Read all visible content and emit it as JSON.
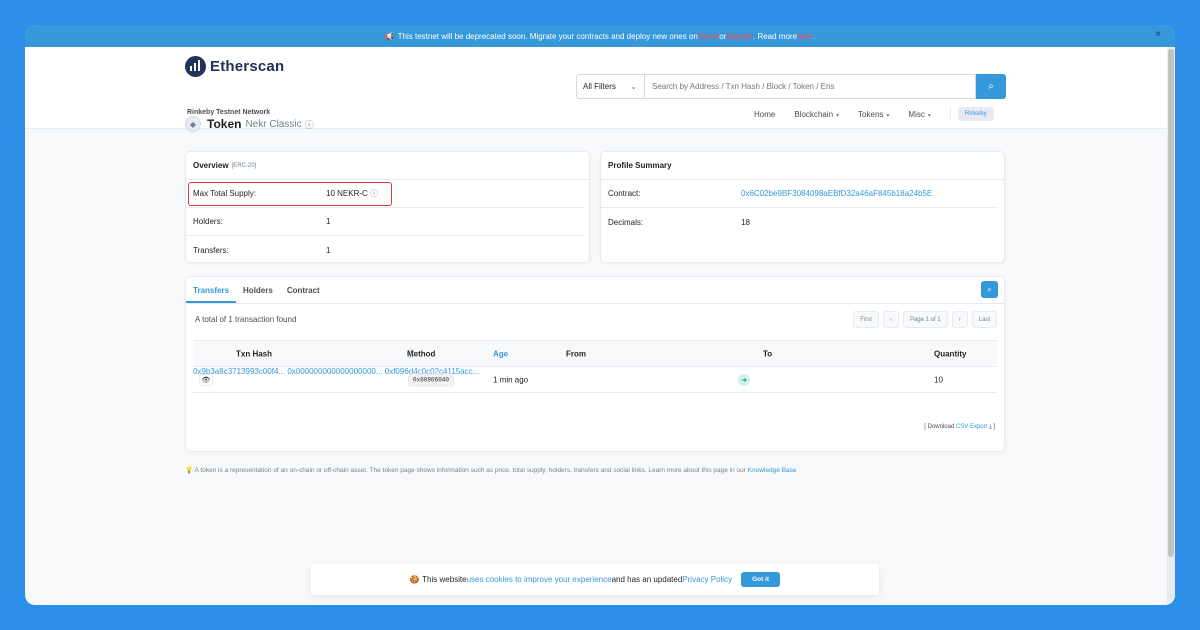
{
  "banner": {
    "text_before": "This testnet will be deprecated soon. Migrate your contracts and deploy new ones on ",
    "link1": "Goerli",
    "text_mid": " or ",
    "link2": "Sepolia",
    "text_after": ". Read more ",
    "link3": "here",
    "text_end": "."
  },
  "header": {
    "logo_text": "Etherscan",
    "network_label": "Rinkeby Testnet Network",
    "search": {
      "filter": "All Filters",
      "placeholder": "Search by Address / Txn Hash / Block / Token / Ens"
    },
    "nav": [
      {
        "label": "Home",
        "dropdown": false
      },
      {
        "label": "Blockchain",
        "dropdown": true
      },
      {
        "label": "Tokens",
        "dropdown": true
      },
      {
        "label": "Misc",
        "dropdown": true
      }
    ],
    "network_badge": "Rinkeby"
  },
  "token": {
    "title": "Token",
    "name": "Nekr Classic"
  },
  "overview": {
    "title": "Overview",
    "subtitle": "[ERC-20]",
    "rows": [
      {
        "label": "Max Total Supply:",
        "value": "10 NEKR-C"
      },
      {
        "label": "Holders:",
        "value": "1"
      },
      {
        "label": "Transfers:",
        "value": "1"
      }
    ]
  },
  "profile": {
    "title": "Profile Summary",
    "rows": [
      {
        "label": "Contract:",
        "value": "0x6C02be9BF3084098aEBfD32a46aF845b18a24b5E"
      },
      {
        "label": "Decimals:",
        "value": "18"
      }
    ]
  },
  "transfers": {
    "tabs": [
      "Transfers",
      "Holders",
      "Contract"
    ],
    "found_text": "A total of 1 transaction found",
    "pager": {
      "first": "First",
      "prev": "‹",
      "page": "Page 1 of 1",
      "next": "›",
      "last": "Last"
    },
    "columns": {
      "hash": "Txn Hash",
      "method": "Method",
      "age": "Age",
      "from": "From",
      "to": "To",
      "quantity": "Quantity"
    },
    "rows": [
      {
        "hash": "0x9b3a8c3713993c00f4...",
        "method": "0x60806040",
        "age": "1 min ago",
        "from": "0x000000000000000000...",
        "to": "0xf096d4c0c02c4115acc...",
        "quantity": "10"
      }
    ],
    "csv": {
      "prefix": "[ Download ",
      "link": "CSV Export",
      "suffix": " ]"
    }
  },
  "note": {
    "text": "A token is a representation of an on-chain or off-chain asset. The token page shows information such as price, total supply, holders, transfers and social links. Learn more about this page in our ",
    "link": "Knowledge Base"
  },
  "cookie": {
    "text_before": "This website ",
    "link1": "uses cookies to improve your experience",
    "text_mid": " and has an updated ",
    "link2": "Privacy Policy",
    "button": "Got it"
  }
}
